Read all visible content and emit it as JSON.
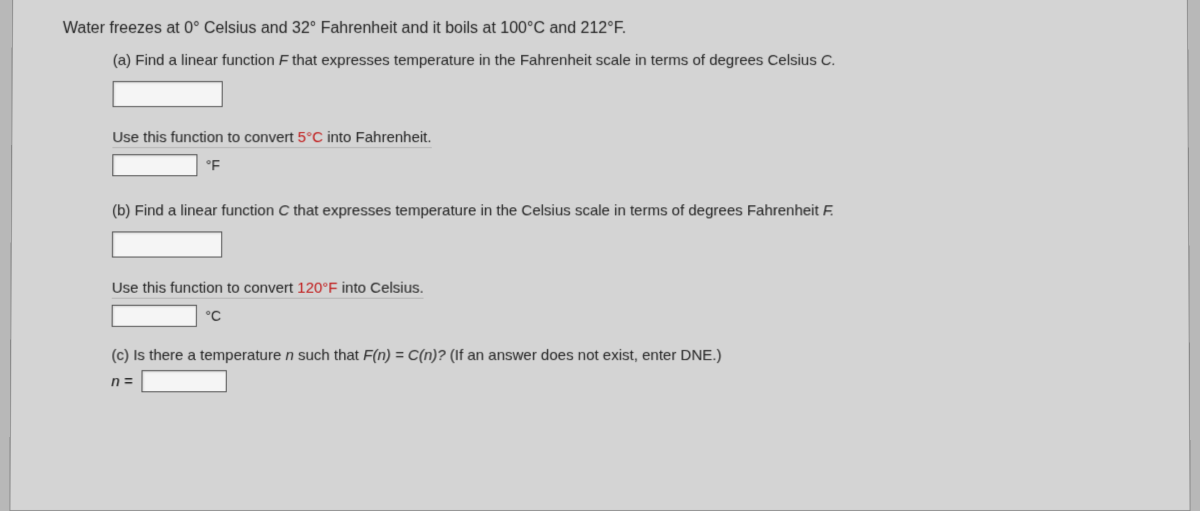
{
  "intro": "Water freezes at 0° Celsius and 32° Fahrenheit and it boils at 100°C and 212°F.",
  "partA": {
    "label": "(a) Find a linear function ",
    "fvar": "F",
    "rest": " that expresses temperature in the Fahrenheit scale in terms of degrees Celsius ",
    "cvar": "C.",
    "sub": "Use this function to convert ",
    "val": "5°C",
    "sub2": " into Fahrenheit.",
    "unit": "°F"
  },
  "partB": {
    "label": "(b) Find a linear function ",
    "cvar": "C",
    "rest": " that expresses temperature in the Celsius scale in terms of degrees Fahrenheit ",
    "fvar": "F.",
    "sub": "Use this function to convert ",
    "val": "120°F",
    "sub2": " into Celsius.",
    "unit": "°C"
  },
  "partC": {
    "label": "(c) Is there a temperature ",
    "nvar": "n",
    "rest": " such that ",
    "eq": "F(n) = C(n)?",
    "hint": "  (If an answer does not exist, enter DNE.)",
    "neq": "n ="
  }
}
